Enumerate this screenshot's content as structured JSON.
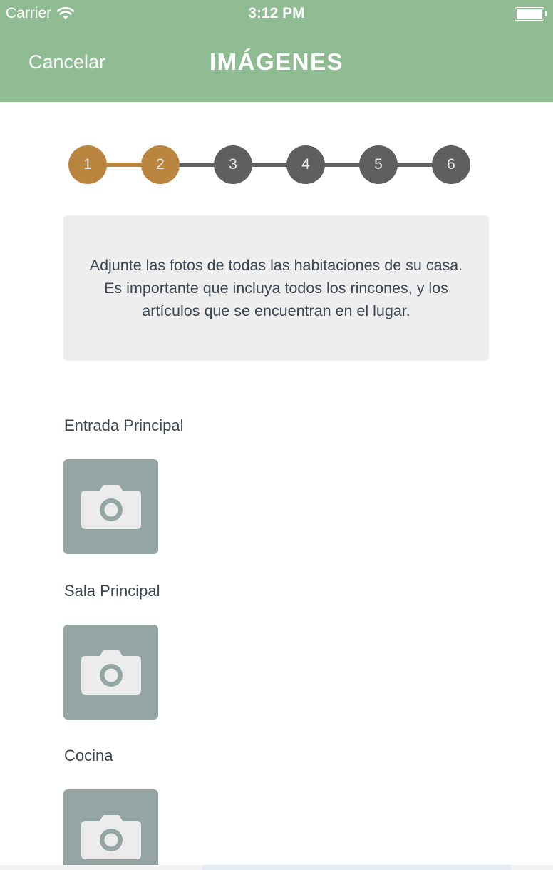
{
  "status_bar": {
    "carrier": "Carrier",
    "time": "3:12 PM"
  },
  "nav": {
    "cancel_label": "Cancelar",
    "title": "IMÁGENES"
  },
  "stepper": {
    "current_step": 2,
    "steps": [
      {
        "label": "1",
        "state": "done"
      },
      {
        "label": "2",
        "state": "done"
      },
      {
        "label": "3",
        "state": "todo"
      },
      {
        "label": "4",
        "state": "todo"
      },
      {
        "label": "5",
        "state": "todo"
      },
      {
        "label": "6",
        "state": "todo"
      }
    ]
  },
  "info": {
    "text": "Adjunte las fotos de todas las habitaciones de su casa. Es importante que incluya todos los rincones, y los artículos que se encuentran en el lugar."
  },
  "sections": [
    {
      "label": "Entrada Principal",
      "icon": "camera-icon"
    },
    {
      "label": "Sala Principal",
      "icon": "camera-icon"
    },
    {
      "label": "Cocina",
      "icon": "camera-icon"
    }
  ],
  "colors": {
    "header_bg": "#8fbc93",
    "step_done": "#b9853f",
    "step_todo": "#5f5f5f",
    "info_bg": "#eeeeee",
    "photo_bg": "#94a5a4",
    "text": "#3d4651"
  }
}
